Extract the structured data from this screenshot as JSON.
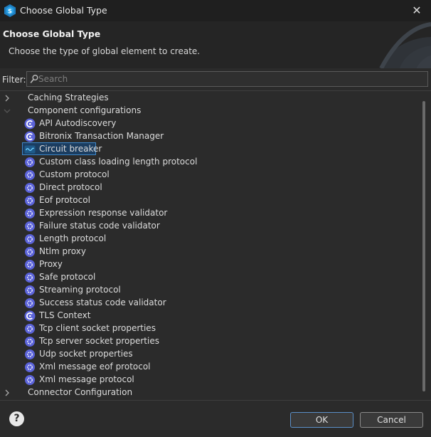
{
  "window": {
    "title": "Choose Global Type",
    "close_glyph": "✕"
  },
  "header": {
    "title": "Choose Global Type",
    "description": "Choose the type of global element to create."
  },
  "filter": {
    "label": "Filter:",
    "placeholder": "Search",
    "value": ""
  },
  "tree": {
    "categories": [
      {
        "label": "Caching Strategies",
        "expanded": false
      },
      {
        "label": "Component configurations",
        "expanded": true
      },
      {
        "label": "Connector Configuration",
        "expanded": false
      }
    ],
    "items": [
      {
        "label": "API Autodiscovery",
        "icon": "config-c-icon"
      },
      {
        "label": "Bitronix Transaction Manager",
        "icon": "config-c-icon"
      },
      {
        "label": "Circuit breaker",
        "icon": "circuit-breaker-icon",
        "selected": true
      },
      {
        "label": "Custom class loading length protocol",
        "icon": "protocol-icon"
      },
      {
        "label": "Custom protocol",
        "icon": "protocol-icon"
      },
      {
        "label": "Direct protocol",
        "icon": "protocol-icon"
      },
      {
        "label": "Eof protocol",
        "icon": "protocol-icon"
      },
      {
        "label": "Expression response validator",
        "icon": "protocol-icon"
      },
      {
        "label": "Failure status code validator",
        "icon": "protocol-icon"
      },
      {
        "label": "Length protocol",
        "icon": "protocol-icon"
      },
      {
        "label": "Ntlm proxy",
        "icon": "protocol-icon"
      },
      {
        "label": "Proxy",
        "icon": "protocol-icon"
      },
      {
        "label": "Safe protocol",
        "icon": "protocol-icon"
      },
      {
        "label": "Streaming protocol",
        "icon": "protocol-icon"
      },
      {
        "label": "Success status code validator",
        "icon": "protocol-icon"
      },
      {
        "label": "TLS Context",
        "icon": "config-c-icon"
      },
      {
        "label": "Tcp client socket properties",
        "icon": "protocol-icon"
      },
      {
        "label": "Tcp server socket properties",
        "icon": "protocol-icon"
      },
      {
        "label": "Udp socket properties",
        "icon": "protocol-icon"
      },
      {
        "label": "Xml message eof protocol",
        "icon": "protocol-icon"
      },
      {
        "label": "Xml message protocol",
        "icon": "protocol-icon"
      }
    ]
  },
  "footer": {
    "help_glyph": "?",
    "ok_label": "OK",
    "cancel_label": "Cancel"
  },
  "colors": {
    "background": "#2b2b2b",
    "titlebar": "#1f1f1f",
    "icon_accent": "#5b63d9",
    "selection_fill": "#1b3d60",
    "selection_border": "#3d86c8"
  }
}
